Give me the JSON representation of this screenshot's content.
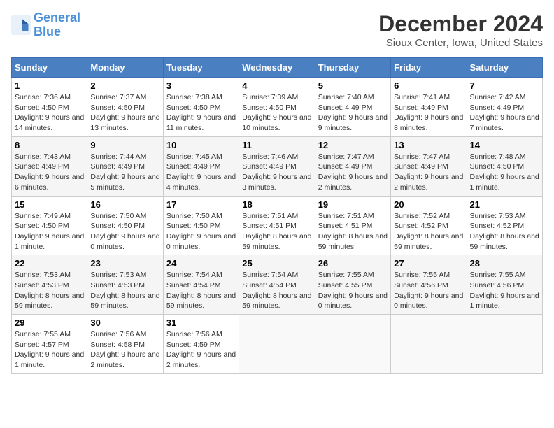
{
  "logo": {
    "line1": "General",
    "line2": "Blue"
  },
  "title": "December 2024",
  "location": "Sioux Center, Iowa, United States",
  "weekdays": [
    "Sunday",
    "Monday",
    "Tuesday",
    "Wednesday",
    "Thursday",
    "Friday",
    "Saturday"
  ],
  "weeks": [
    [
      {
        "day": "1",
        "sunrise": "7:36 AM",
        "sunset": "4:50 PM",
        "daylight": "9 hours and 14 minutes."
      },
      {
        "day": "2",
        "sunrise": "7:37 AM",
        "sunset": "4:50 PM",
        "daylight": "9 hours and 13 minutes."
      },
      {
        "day": "3",
        "sunrise": "7:38 AM",
        "sunset": "4:50 PM",
        "daylight": "9 hours and 11 minutes."
      },
      {
        "day": "4",
        "sunrise": "7:39 AM",
        "sunset": "4:50 PM",
        "daylight": "9 hours and 10 minutes."
      },
      {
        "day": "5",
        "sunrise": "7:40 AM",
        "sunset": "4:49 PM",
        "daylight": "9 hours and 9 minutes."
      },
      {
        "day": "6",
        "sunrise": "7:41 AM",
        "sunset": "4:49 PM",
        "daylight": "9 hours and 8 minutes."
      },
      {
        "day": "7",
        "sunrise": "7:42 AM",
        "sunset": "4:49 PM",
        "daylight": "9 hours and 7 minutes."
      }
    ],
    [
      {
        "day": "8",
        "sunrise": "7:43 AM",
        "sunset": "4:49 PM",
        "daylight": "9 hours and 6 minutes."
      },
      {
        "day": "9",
        "sunrise": "7:44 AM",
        "sunset": "4:49 PM",
        "daylight": "9 hours and 5 minutes."
      },
      {
        "day": "10",
        "sunrise": "7:45 AM",
        "sunset": "4:49 PM",
        "daylight": "9 hours and 4 minutes."
      },
      {
        "day": "11",
        "sunrise": "7:46 AM",
        "sunset": "4:49 PM",
        "daylight": "9 hours and 3 minutes."
      },
      {
        "day": "12",
        "sunrise": "7:47 AM",
        "sunset": "4:49 PM",
        "daylight": "9 hours and 2 minutes."
      },
      {
        "day": "13",
        "sunrise": "7:47 AM",
        "sunset": "4:49 PM",
        "daylight": "9 hours and 2 minutes."
      },
      {
        "day": "14",
        "sunrise": "7:48 AM",
        "sunset": "4:50 PM",
        "daylight": "9 hours and 1 minute."
      }
    ],
    [
      {
        "day": "15",
        "sunrise": "7:49 AM",
        "sunset": "4:50 PM",
        "daylight": "9 hours and 1 minute."
      },
      {
        "day": "16",
        "sunrise": "7:50 AM",
        "sunset": "4:50 PM",
        "daylight": "9 hours and 0 minutes."
      },
      {
        "day": "17",
        "sunrise": "7:50 AM",
        "sunset": "4:50 PM",
        "daylight": "9 hours and 0 minutes."
      },
      {
        "day": "18",
        "sunrise": "7:51 AM",
        "sunset": "4:51 PM",
        "daylight": "8 hours and 59 minutes."
      },
      {
        "day": "19",
        "sunrise": "7:51 AM",
        "sunset": "4:51 PM",
        "daylight": "8 hours and 59 minutes."
      },
      {
        "day": "20",
        "sunrise": "7:52 AM",
        "sunset": "4:52 PM",
        "daylight": "8 hours and 59 minutes."
      },
      {
        "day": "21",
        "sunrise": "7:53 AM",
        "sunset": "4:52 PM",
        "daylight": "8 hours and 59 minutes."
      }
    ],
    [
      {
        "day": "22",
        "sunrise": "7:53 AM",
        "sunset": "4:53 PM",
        "daylight": "8 hours and 59 minutes."
      },
      {
        "day": "23",
        "sunrise": "7:53 AM",
        "sunset": "4:53 PM",
        "daylight": "8 hours and 59 minutes."
      },
      {
        "day": "24",
        "sunrise": "7:54 AM",
        "sunset": "4:54 PM",
        "daylight": "8 hours and 59 minutes."
      },
      {
        "day": "25",
        "sunrise": "7:54 AM",
        "sunset": "4:54 PM",
        "daylight": "8 hours and 59 minutes."
      },
      {
        "day": "26",
        "sunrise": "7:55 AM",
        "sunset": "4:55 PM",
        "daylight": "9 hours and 0 minutes."
      },
      {
        "day": "27",
        "sunrise": "7:55 AM",
        "sunset": "4:56 PM",
        "daylight": "9 hours and 0 minutes."
      },
      {
        "day": "28",
        "sunrise": "7:55 AM",
        "sunset": "4:56 PM",
        "daylight": "9 hours and 1 minute."
      }
    ],
    [
      {
        "day": "29",
        "sunrise": "7:55 AM",
        "sunset": "4:57 PM",
        "daylight": "9 hours and 1 minute."
      },
      {
        "day": "30",
        "sunrise": "7:56 AM",
        "sunset": "4:58 PM",
        "daylight": "9 hours and 2 minutes."
      },
      {
        "day": "31",
        "sunrise": "7:56 AM",
        "sunset": "4:59 PM",
        "daylight": "9 hours and 2 minutes."
      },
      null,
      null,
      null,
      null
    ]
  ]
}
